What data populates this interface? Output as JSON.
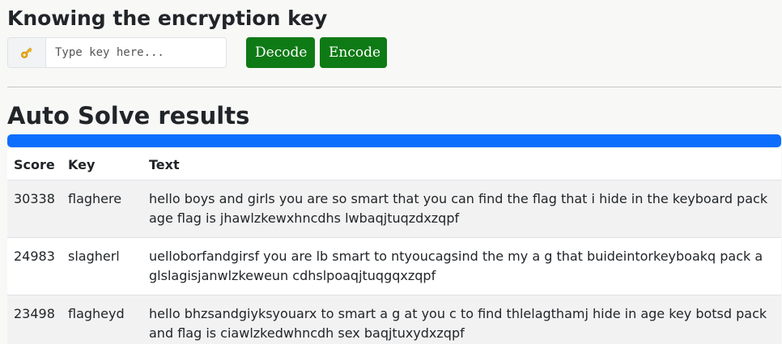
{
  "known_key": {
    "heading": "Knowing the encryption key",
    "icon": "key-icon",
    "input_placeholder": "Type key here...",
    "input_value": "",
    "decode_label": "Decode",
    "encode_label": "Encode",
    "button_color": "#0e7a15"
  },
  "auto_solve": {
    "heading": "Auto Solve results",
    "progress_percent": 100,
    "progress_color": "#0d6efd",
    "columns": [
      "Score",
      "Key",
      "Text"
    ],
    "rows": [
      {
        "score": "30338",
        "key": "flaghere",
        "text": "hello boys and girls you are so smart that you can find the flag that i hide in the keyboard package flag is jhawlzkewxhncdhs lwbaqjtuqzdxzqpf"
      },
      {
        "score": "24983",
        "key": "slagherl",
        "text": "uelloborfandgirsf you are lb smart to ntyoucagsind the my a g that buideintorkeyboakq pack a glslagisjanwlzkeweun cdhslpoaqjtuqgqxzqpf"
      },
      {
        "score": "23498",
        "key": "flagheyd",
        "text": "hello bhzsandgiyksyouarx to smart a g at you c to find thlelagthamj hide in age key botsd pack and flag is ciawlzkedwhncdh sex baqjtuxydxzqpf"
      }
    ]
  }
}
